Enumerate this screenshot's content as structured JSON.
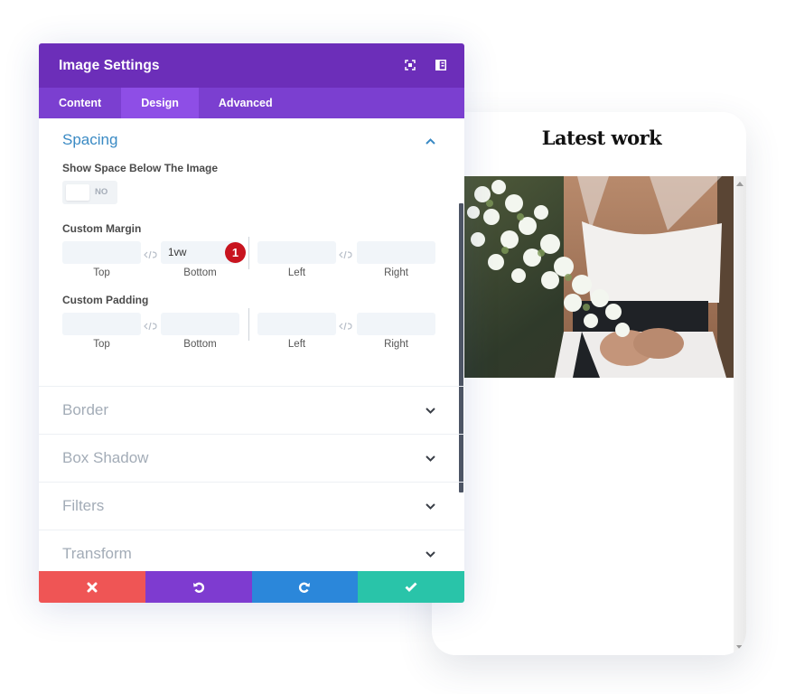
{
  "modal": {
    "title": "Image Settings",
    "header_icons": [
      "fullscreen-icon",
      "sidebar-layout-icon"
    ],
    "tabs": [
      {
        "label": "Content",
        "active": false
      },
      {
        "label": "Design",
        "active": true
      },
      {
        "label": "Advanced",
        "active": false
      }
    ],
    "sections": {
      "spacing": {
        "title": "Spacing",
        "expanded": true,
        "show_space_label": "Show Space Below The Image",
        "show_space_toggle": "NO",
        "margin": {
          "label": "Custom Margin",
          "fields": [
            {
              "caption": "Top",
              "value": ""
            },
            {
              "caption": "Bottom",
              "value": "1vw"
            },
            {
              "caption": "Left",
              "value": ""
            },
            {
              "caption": "Right",
              "value": ""
            }
          ],
          "badge": "1"
        },
        "padding": {
          "label": "Custom Padding",
          "fields": [
            {
              "caption": "Top",
              "value": ""
            },
            {
              "caption": "Bottom",
              "value": ""
            },
            {
              "caption": "Left",
              "value": ""
            },
            {
              "caption": "Right",
              "value": ""
            }
          ]
        }
      },
      "collapsed": [
        {
          "title": "Border"
        },
        {
          "title": "Box Shadow"
        },
        {
          "title": "Filters"
        },
        {
          "title": "Transform"
        }
      ]
    },
    "footer": {
      "buttons": [
        {
          "name": "discard",
          "icon": "close-icon",
          "color": "#ef5555"
        },
        {
          "name": "undo",
          "icon": "undo-icon",
          "color": "#7e3bd0"
        },
        {
          "name": "redo",
          "icon": "redo-icon",
          "color": "#2b87da"
        },
        {
          "name": "save",
          "icon": "check-icon",
          "color": "#29c4a9"
        }
      ]
    }
  },
  "preview": {
    "heading": "Latest work",
    "image_alt": "bride holding white flower bouquet"
  },
  "colors": {
    "header": "#6c2eb9",
    "tabs": "#7b3fd0",
    "tab_active": "#8e4ee6",
    "accent_blue": "#3a8ac4",
    "badge": "#c8141f"
  }
}
